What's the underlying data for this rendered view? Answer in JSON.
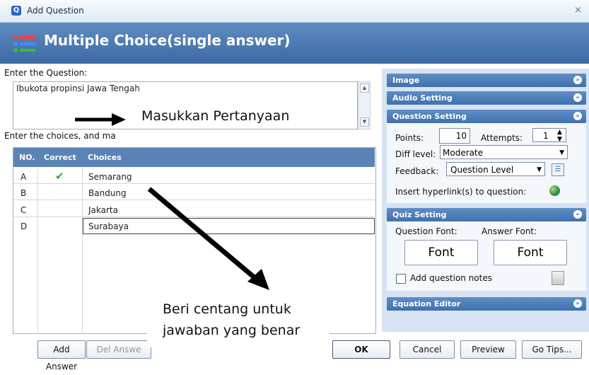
{
  "window": {
    "title": "Add Question",
    "close": "×",
    "app_icon": "Q"
  },
  "header": {
    "title": "Multiple Choice(single answer)",
    "icon": "list-icon"
  },
  "question": {
    "label": "Enter the Question:",
    "value": "Ibukota propinsi Jawa Tengah"
  },
  "choices": {
    "label": "Enter the choices, and ma",
    "columns": [
      "NO.",
      "Correct",
      "Choices"
    ],
    "rows": [
      {
        "no": "A",
        "correct": "✔",
        "text": "Semarang"
      },
      {
        "no": "B",
        "correct": "",
        "text": "Bandung"
      },
      {
        "no": "C",
        "correct": "",
        "text": "Jakarta"
      },
      {
        "no": "D",
        "correct": "",
        "text": "Surabaya"
      }
    ]
  },
  "buttons": {
    "add_answer": "Add Answer",
    "del_answer": "Del Answe",
    "ok": "OK",
    "cancel": "Cancel",
    "preview": "Preview",
    "go_tips": "Go Tips..."
  },
  "right": {
    "image": "Image",
    "audio": "Audio Setting",
    "question_setting": "Question Setting",
    "points_label": "Points:",
    "points_value": "10",
    "attempts_label": "Attempts:",
    "attempts_value": "1",
    "diff_label": "Diff level:",
    "diff_value": "Moderate",
    "feedback_label": "Feedback:",
    "feedback_value": "Question Level",
    "hyperlink_label": "Insert hyperlink(s) to question:",
    "quiz_setting": "Quiz Setting",
    "question_font_label": "Question Font:",
    "answer_font_label": "Answer Font:",
    "font_btn_1": "Font",
    "font_btn_2": "Font",
    "add_notes_label": "Add question notes",
    "equation_editor": "Equation Editor"
  },
  "annotations": {
    "question_hint": "Masukkan Pertanyaan",
    "correct_hint_1": "Beri centang untuk",
    "correct_hint_2": "jawaban yang benar"
  },
  "colors": {
    "banner": "#4a77ae",
    "grid_header": "#5b84b6",
    "check": "#2fa82f",
    "panel_bg": "#d7e3f2"
  }
}
